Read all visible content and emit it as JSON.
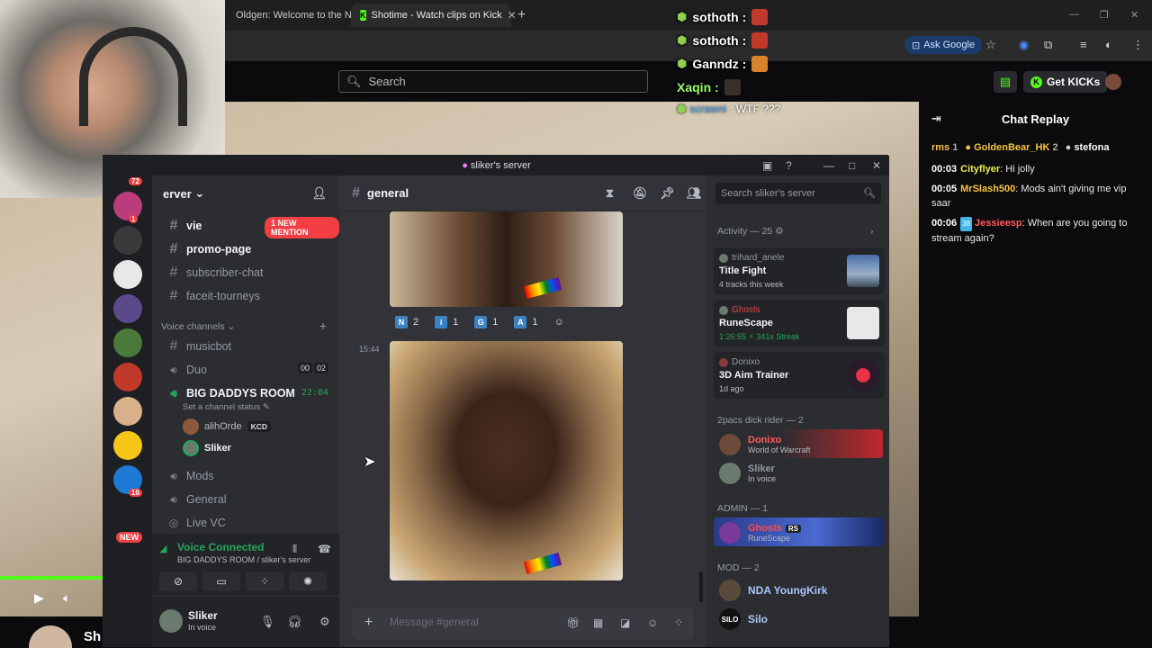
{
  "browser": {
    "tabs": [
      {
        "label": "Oldgen: Welcome to the N"
      },
      {
        "label": "Shotime - Watch clips on Kick"
      }
    ],
    "ask_google": "Ask Google"
  },
  "kick": {
    "search_placeholder": "Search",
    "get_kicks": "Get KICKs",
    "streamer_name": "Sh"
  },
  "overlay": {
    "rows": [
      {
        "name": "sothoth :"
      },
      {
        "name": "sothoth :"
      },
      {
        "name": "Ganndz :"
      },
      {
        "name": "Xaqin :"
      }
    ],
    "last_user": "scrawni",
    "last_text": ": WTF ???"
  },
  "chat_replay": {
    "title": "Chat Replay",
    "gifters": [
      {
        "name": "rms",
        "count": "1"
      },
      {
        "name": "GoldenBear_HK",
        "count": "2"
      },
      {
        "name": "stefona",
        "count": ""
      }
    ],
    "messages": [
      {
        "time": "00:03",
        "user": "Cityflyer",
        "text": ": Hi jolly"
      },
      {
        "time": "00:05",
        "user": "MrSlash500",
        "text": ": Mods ain't giving me vip saar"
      },
      {
        "time": "00:06",
        "badge": "38",
        "user": "Jessieesp",
        "text": ": When are you going to stream again?"
      }
    ]
  },
  "discord": {
    "window_title": "sliker's server",
    "server_name": "erver",
    "guild_badges": {
      "top": "72",
      "b1": "1",
      "b2": "16",
      "new": "NEW"
    },
    "channels": {
      "vie": "vie",
      "new_mention": "1 NEW MENTION",
      "promo": "promo-page",
      "subscriber": "subscriber-chat",
      "faceit": "faceit-tourneys",
      "voice_category": "Voice channels",
      "musicbot": "musicbot",
      "duo": "Duo",
      "duo_counts": [
        "00",
        "02"
      ],
      "big_daddys": "BIG DADDYS ROOM",
      "big_daddys_timer": "22:04",
      "set_status": "Set a channel status",
      "voice_users": [
        {
          "name": "alihOrde",
          "tag": "KCD"
        },
        {
          "name": "Sliker",
          "tag": ""
        }
      ],
      "mods": "Mods",
      "general": "General",
      "live_vc": "Live VC"
    },
    "voice_connected": {
      "title": "Voice Connected",
      "sub": "BIG DADDYS ROOM / sliker's server"
    },
    "user_panel": {
      "name": "Sliker",
      "status": "In voice"
    },
    "main": {
      "channel": "general",
      "reactions": [
        {
          "letter": "N",
          "count": "2"
        },
        {
          "letter": "i",
          "count": "1"
        },
        {
          "letter": "G",
          "count": "1"
        },
        {
          "letter": "A",
          "count": "1"
        }
      ],
      "timestamp": "15:44",
      "message_placeholder": "Message #general"
    },
    "members": {
      "search_placeholder": "Search sliker's server",
      "activity_header": "Activity — 25",
      "activities": [
        {
          "user": "trihard_anele",
          "title": "Title Fight",
          "sub": "4 tracks this week"
        },
        {
          "user": "Ghosts",
          "title": "RuneScape",
          "sub": "1:26:55  ⚡ 341x Streak"
        },
        {
          "user": "Donixo",
          "title": "3D Aim Trainer",
          "sub": "1d ago"
        }
      ],
      "group1": "2pacs dick rider — 2",
      "group1_members": [
        {
          "name": "Donixo",
          "sub": "World of Warcraft"
        },
        {
          "name": "Sliker",
          "sub": "In voice"
        }
      ],
      "group2": "ADMIN — 1",
      "group2_members": [
        {
          "name": "Ghosts",
          "tag": "RS",
          "sub": "RuneScape"
        }
      ],
      "group3": "MOD — 2",
      "group3_members": [
        {
          "name": "NDA YoungKirk"
        },
        {
          "name": "Silo"
        }
      ]
    }
  }
}
